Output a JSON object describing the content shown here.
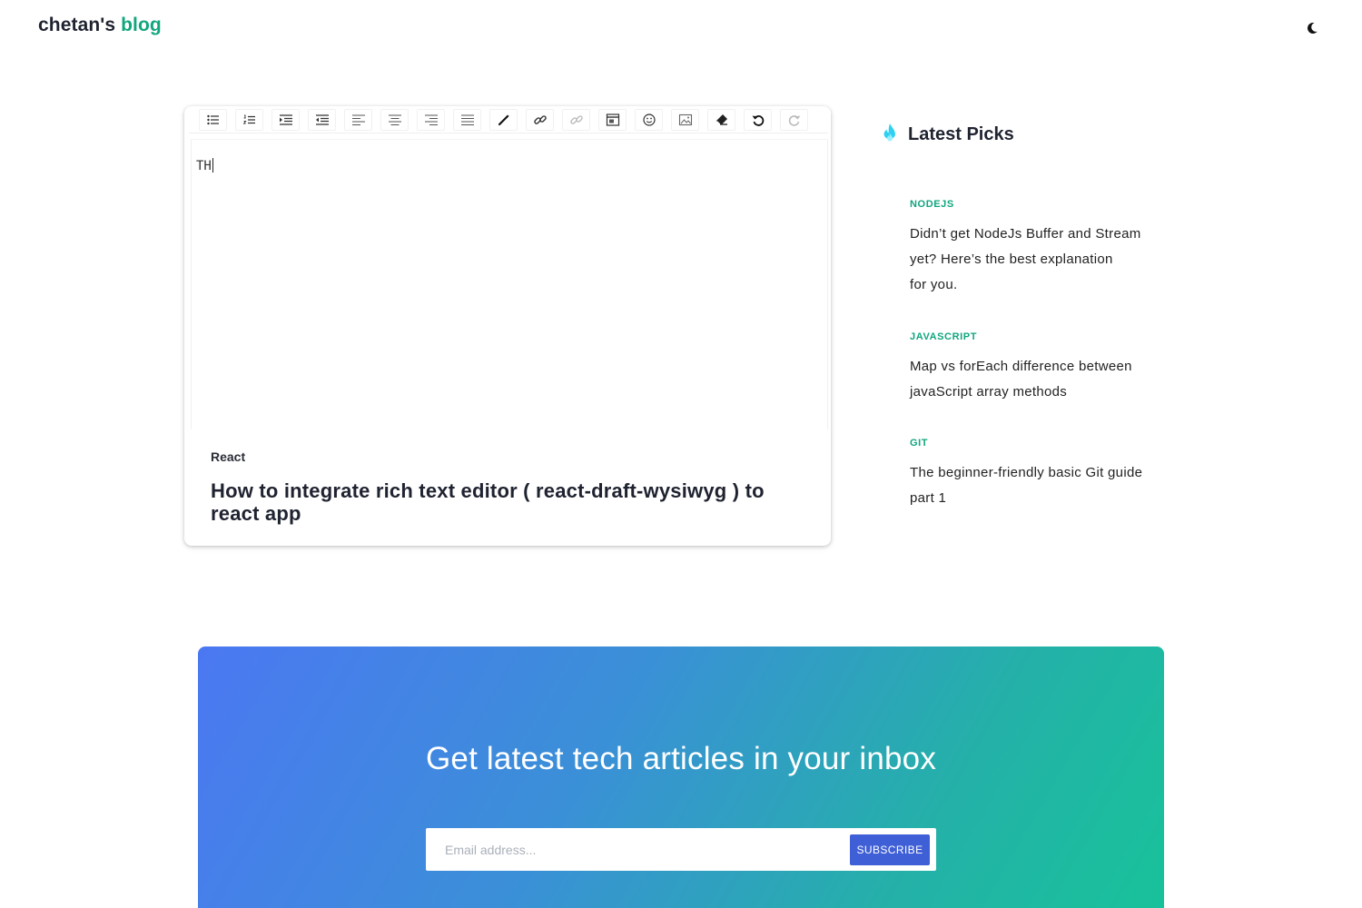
{
  "header": {
    "brand_name": "chetan's",
    "brand_accent": "blog",
    "theme_toggle_icon": "moon-icon"
  },
  "featured": {
    "toolbar": [
      "unordered-list-icon",
      "ordered-list-icon",
      "indent-icon",
      "outdent-icon",
      "align-left-icon",
      "align-center-icon",
      "align-right-icon",
      "align-justify-icon",
      "color-picker-icon",
      "link-icon",
      "unlink-icon",
      "embedded-icon",
      "emoji-icon",
      "image-icon",
      "eraser-icon",
      "undo-icon",
      "redo-icon"
    ],
    "editor_text": "TH",
    "category": "React",
    "title": "How to integrate rich text editor ( react-draft-wysiwyg ) to react app"
  },
  "latest_picks": {
    "icon": "flame-icon",
    "title": "Latest Picks",
    "items": [
      {
        "category": "NODEJS",
        "lines": [
          "Didn’t get NodeJs Buffer and Stream",
          "yet? Here’s the best explanation",
          "for you."
        ]
      },
      {
        "category": "JAVASCRIPT",
        "lines": [
          "Map vs forEach difference between",
          "javaScript array methods"
        ]
      },
      {
        "category": "GIT",
        "lines": [
          "The beginner-friendly basic Git guide",
          "part 1"
        ]
      }
    ]
  },
  "newsletter": {
    "title": "Get latest tech articles in your inbox",
    "email_placeholder": "Email address...",
    "subscribe_label": "SUBSCRIBE"
  },
  "colors": {
    "accent": "#10a67e",
    "gradient_start": "#4b78f2",
    "gradient_end": "#18c29a",
    "button": "#3f5fd6"
  }
}
